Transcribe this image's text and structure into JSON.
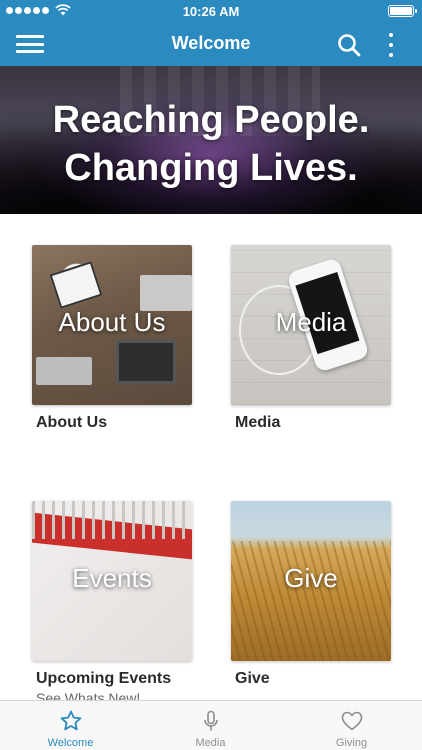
{
  "status_bar": {
    "time": "10:26 AM",
    "signal_dots": 5,
    "battery_level": 1.0
  },
  "nav": {
    "title": "Welcome",
    "menu_icon": "hamburger-menu-icon",
    "search_icon": "search-icon",
    "more_icon": "vertical-ellipsis-icon"
  },
  "hero": {
    "line1": "Reaching People.",
    "line2": "Changing Lives."
  },
  "tiles": [
    {
      "overlay": "About Us",
      "label": "About Us",
      "subtitle": ""
    },
    {
      "overlay": "Media",
      "label": "Media",
      "subtitle": ""
    },
    {
      "overlay": "Events",
      "label": "Upcoming Events",
      "subtitle": "See Whats New!"
    },
    {
      "overlay": "Give",
      "label": "Give",
      "subtitle": ""
    }
  ],
  "tab_bar": {
    "tabs": [
      {
        "label": "Welcome",
        "icon": "star-icon",
        "active": true
      },
      {
        "label": "Media",
        "icon": "microphone-icon",
        "active": false
      },
      {
        "label": "Giving",
        "icon": "heart-icon",
        "active": false
      }
    ]
  },
  "colors": {
    "primary": "#2b8ac0",
    "tab_inactive": "#8e8e93",
    "text": "#2b2b2b"
  }
}
